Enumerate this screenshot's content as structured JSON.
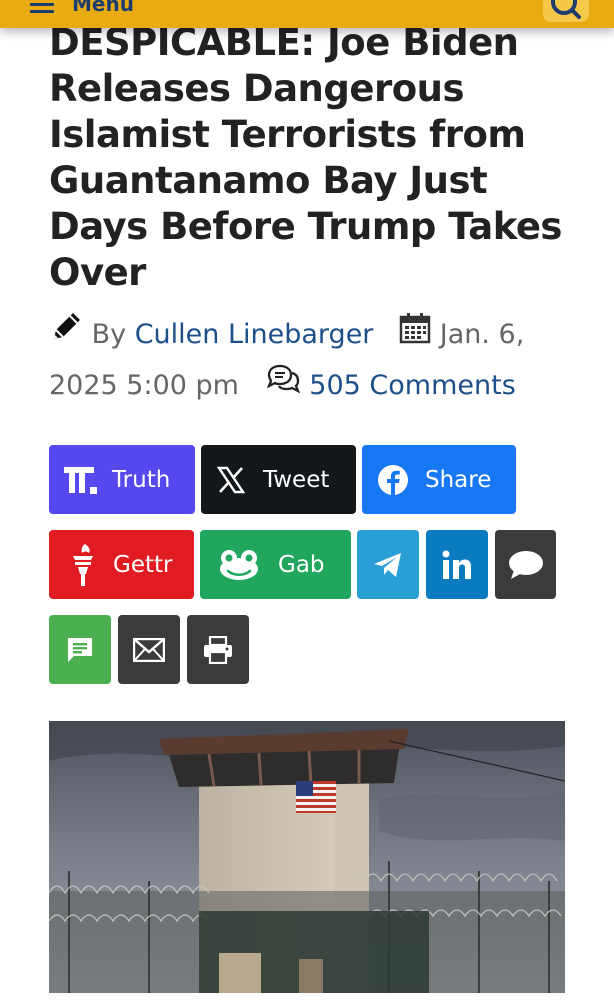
{
  "header": {
    "menu_label": "Menu",
    "bg_color": "#e8ab12",
    "menu_icon": "hamburger-icon",
    "search_icon": "search-icon"
  },
  "article": {
    "title": "DESPICABLE: Joe Biden Releases Dangerous Islamist Terrorists from Guantanamo Bay Just Days Before Trump Takes Over",
    "by_label": "By",
    "author": "Cullen Linebarger",
    "date": "Jan. 6, 2025 5:00 pm",
    "comments": "505 Comments"
  },
  "share": {
    "truth": "Truth",
    "tweet": "Tweet",
    "facebook": "Share",
    "gettr": "Gettr",
    "gab": "Gab",
    "colors": {
      "truth": "#5448ee",
      "x": "#14171a",
      "facebook": "#1877f2",
      "gettr": "#e11b22",
      "gab": "#21a65e",
      "telegram": "#2a9fd6",
      "linkedin": "#0a7bbf",
      "sms": "#3b3b3b",
      "comment": "#4caf50",
      "email": "#3b3b3b",
      "print": "#3b3b3b"
    }
  },
  "image": {
    "subject": "guard tower with american flag and razor wire fence"
  }
}
